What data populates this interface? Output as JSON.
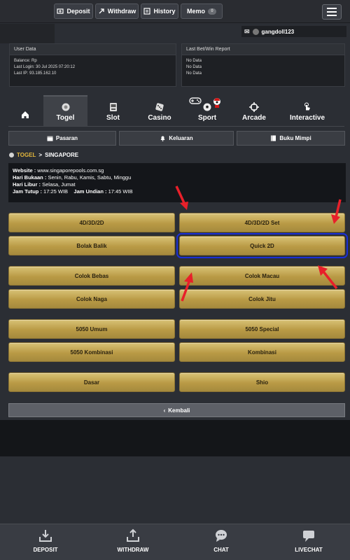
{
  "topnav": {
    "deposit": "Deposit",
    "withdraw": "Withdraw",
    "history": "History",
    "memo": "Memo",
    "memo_count": "0"
  },
  "user": {
    "username": "gangdoll123",
    "message_count": "0"
  },
  "user_data": {
    "title": "User Data",
    "balance": "Balance: Rp",
    "last_login": "Last Login: 30 Jul 2025 07:20:12",
    "last_ip": "Last IP: 93.185.162.10"
  },
  "last_bet": {
    "title": "Last Bet/Win Report",
    "rows": [
      "No Data",
      "No Data",
      "No Data"
    ]
  },
  "categories": [
    {
      "label": "",
      "icon": "home-icon"
    },
    {
      "label": "Togel",
      "icon": "ball-icon",
      "active": true
    },
    {
      "label": "Slot",
      "icon": "slot-icon"
    },
    {
      "label": "Casino",
      "icon": "dice-icon"
    },
    {
      "label": "Sport",
      "icon": "soccer-icon"
    },
    {
      "label": "Arcade",
      "icon": "crosshair-icon"
    },
    {
      "label": "Interactive",
      "icon": "touch-icon"
    }
  ],
  "subnav": {
    "pasaran": "Pasaran",
    "keluaran": "Keluaran",
    "buku_mimpi": "Buku Mimpi"
  },
  "breadcrumb": {
    "root": "TOGEL",
    "separator": ">",
    "current": "SINGAPORE"
  },
  "market_info": {
    "website_label": "Website :",
    "website_value": " www.singaporepools.com.sg",
    "open_label": "Hari Bukaan :",
    "open_value": " Senin, Rabu, Kamis, Sabtu, Minggu",
    "closed_label": "Hari Libur :",
    "closed_value": " Selasa, Jumat",
    "close_time_label": "Jam Tutup :",
    "close_time_value": " 17:25 WIB",
    "draw_time_label": "Jam Undian :",
    "draw_time_value": " 17:45 WIB"
  },
  "bet_types": [
    "4D/3D/2D",
    "4D/3D/2D Set",
    "Bolak Balik",
    "Quick 2D",
    "Colok Bebas",
    "Colok Macau",
    "Colok Naga",
    "Colok Jitu",
    "5050 Umum",
    "5050 Special",
    "5050 Kombinasi",
    "Kombinasi",
    "Dasar",
    "Shio"
  ],
  "back_label": "Kembali",
  "bottomnav": {
    "deposit": "DEPOSIT",
    "withdraw": "WITHDRAW",
    "chat": "CHAT",
    "livechat": "LIVECHAT"
  },
  "colors": {
    "gold": "#c9ad5a",
    "highlight": "#1b2fd6",
    "arrow": "#e8202a",
    "togel_accent": "#e2b63c"
  }
}
